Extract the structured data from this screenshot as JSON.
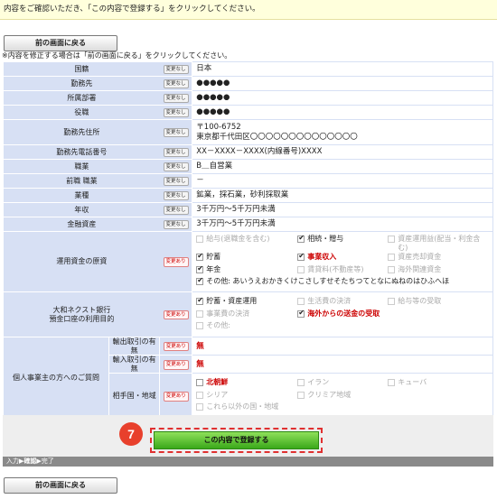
{
  "notice": "内容をご確認いただき、「この内容で登録する」をクリックしてください。",
  "back_button": "前の画面に戻る",
  "hint": "※内容を修正する場合は「前の画面に戻る」をクリックしてください。",
  "badges": {
    "unchanged": "変更なし",
    "changed": "変更あり"
  },
  "rows": [
    {
      "label": "国籍",
      "badge": "変更なし",
      "value": "日本"
    },
    {
      "label": "勤務先",
      "badge": "変更なし",
      "value": "●●●●●"
    },
    {
      "label": "所属部署",
      "badge": "変更なし",
      "value": "●●●●●"
    },
    {
      "label": "役職",
      "badge": "変更なし",
      "value": "●●●●●"
    },
    {
      "label": "勤務先住所",
      "badge": "変更なし",
      "value": "〒100-6752",
      "value2": "東京都千代田区〇〇〇〇〇〇〇〇〇〇〇〇〇〇"
    },
    {
      "label": "勤務先電話番号",
      "badge": "変更なし",
      "value": "XX－XXXX－XXXX(内線番号)XXXX"
    },
    {
      "label": "職業",
      "badge": "変更なし",
      "value": "B＿自営業"
    },
    {
      "label": "前職 職業",
      "badge": "変更なし",
      "value": "－"
    },
    {
      "label": "業種",
      "badge": "変更なし",
      "value": "鉱業，採石業，砂利採取業"
    },
    {
      "label": "年収",
      "badge": "変更なし",
      "value": "3千万円～5千万円未満"
    },
    {
      "label": "金融資産",
      "badge": "変更なし",
      "value": "3千万円～5千万円未満"
    }
  ],
  "funds_source": {
    "label": "運用資金の原資",
    "badge": "変更あり",
    "options": [
      {
        "text": "給与(退職金を含む)",
        "state": "off"
      },
      {
        "text": "相続・贈与",
        "state": "on"
      },
      {
        "text": "資産運用益(配当・利金含む)",
        "state": "off"
      },
      {
        "text": "貯蓄",
        "state": "on"
      },
      {
        "text": "事業収入",
        "state": "on-red"
      },
      {
        "text": "資産売却資金",
        "state": "off"
      },
      {
        "text": "年金",
        "state": "on"
      },
      {
        "text": "賃貸料(不動産等)",
        "state": "off"
      },
      {
        "text": "海外関連資金",
        "state": "off"
      }
    ],
    "other": "その他: あいうえおかきくけこさしすせそたちつてとなにぬねのはひふへほ"
  },
  "account_purpose": {
    "label_line1": "大和ネクスト銀行",
    "label_line2": "預金口座の利用目的",
    "badge": "変更あり",
    "options": [
      {
        "text": "貯蓄・資産運用",
        "state": "on"
      },
      {
        "text": "生活費の決済",
        "state": "off"
      },
      {
        "text": "給与等の受取",
        "state": "off"
      },
      {
        "text": "事業費の決済",
        "state": "off"
      },
      {
        "text": "海外からの送金の受取",
        "state": "on-red"
      }
    ],
    "other": "その他:"
  },
  "sole_proprietor": {
    "label": "個人事業主の方へのご質問",
    "export": {
      "label": "輸出取引の有無",
      "badge": "変更あり",
      "value": "無"
    },
    "import": {
      "label": "輸入取引の有無",
      "badge": "変更あり",
      "value": "無"
    },
    "partner": {
      "label": "相手国・地域",
      "badge": "変更あり",
      "options": [
        {
          "text": "北朝鮮",
          "state": "red"
        },
        {
          "text": "イラン",
          "state": "off"
        },
        {
          "text": "キューバ",
          "state": "off"
        },
        {
          "text": "シリア",
          "state": "off"
        },
        {
          "text": "クリミア地域",
          "state": "off"
        }
      ],
      "other": "これら以外の国・地域"
    }
  },
  "step_number": "7",
  "submit_button": "この内容で登録する",
  "progress": {
    "step1": "入力",
    "step2": "確認",
    "step3": "完了"
  }
}
